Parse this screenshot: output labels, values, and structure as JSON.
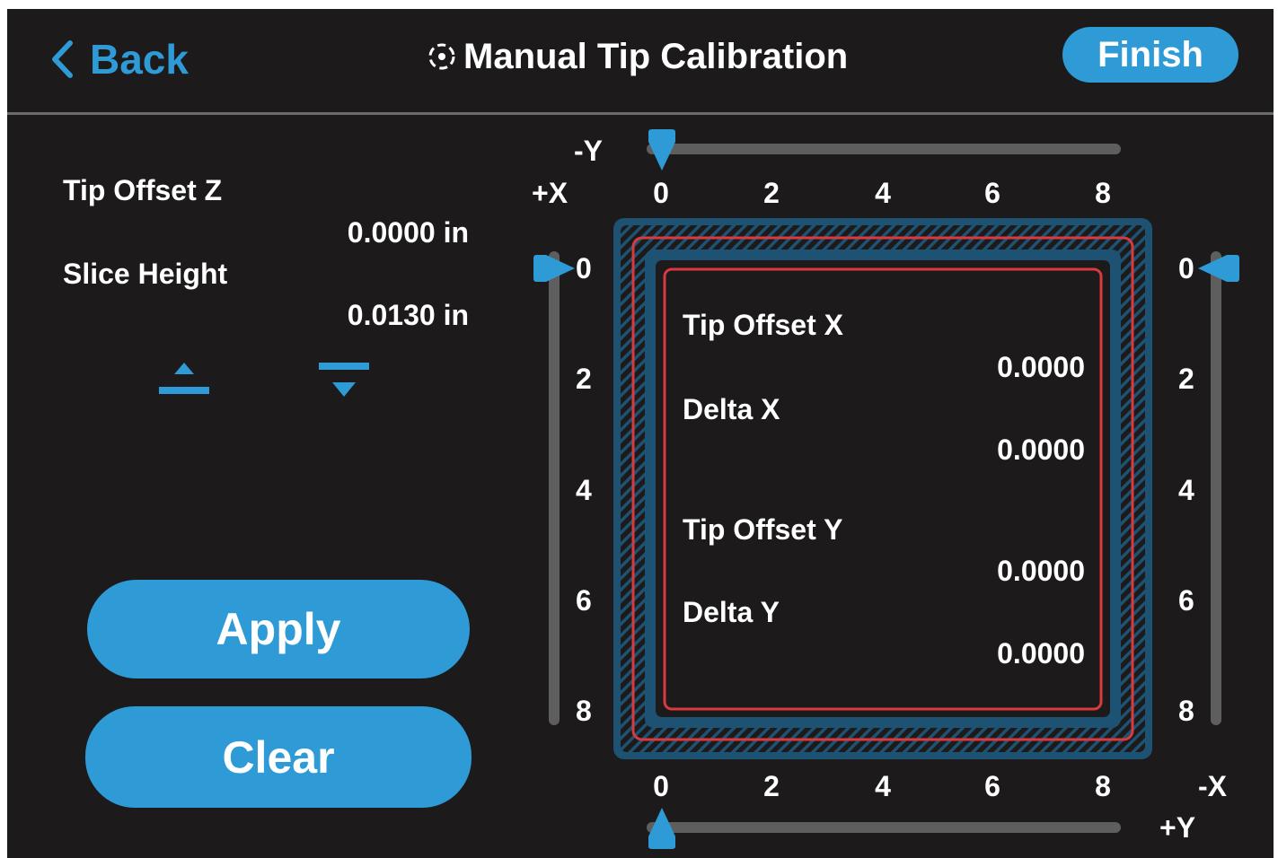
{
  "header": {
    "back_label": "Back",
    "title": "Manual Tip Calibration",
    "finish_label": "Finish"
  },
  "left_panel": {
    "tip_offset_z_label": "Tip Offset Z",
    "tip_offset_z_value": "0.0000 in",
    "slice_height_label": "Slice Height",
    "slice_height_value": "0.0130 in",
    "apply_label": "Apply",
    "clear_label": "Clear"
  },
  "axes": {
    "neg_y_label": "-Y",
    "pos_x_label": "+X",
    "neg_x_label": "-X",
    "pos_y_label": "+Y",
    "top_ticks": [
      "0",
      "2",
      "4",
      "6",
      "8"
    ],
    "bottom_ticks": [
      "0",
      "2",
      "4",
      "6",
      "8"
    ],
    "left_ticks": [
      "0",
      "2",
      "4",
      "6",
      "8"
    ],
    "right_ticks": [
      "0",
      "2",
      "4",
      "6",
      "8"
    ]
  },
  "sliders": {
    "top_value": 0,
    "bottom_value": 0,
    "left_value": 0,
    "right_value": 0
  },
  "readouts": {
    "tip_offset_x_label": "Tip Offset X",
    "tip_offset_x_value": "0.0000",
    "delta_x_label": "Delta X",
    "delta_x_value": "0.0000",
    "tip_offset_y_label": "Tip Offset Y",
    "tip_offset_y_value": "0.0000",
    "delta_y_label": "Delta Y",
    "delta_y_value": "0.0000"
  },
  "colors": {
    "background": "#1c1a1b",
    "accent": "#2e9ad6",
    "plate_blue": "#1d5272",
    "outline_red": "#d83a3f",
    "track": "#5e5e5e"
  },
  "icons": {
    "back": "chevron-left-icon",
    "title": "target-icon",
    "raise": "platform-up-icon",
    "lower": "platform-down-icon"
  }
}
